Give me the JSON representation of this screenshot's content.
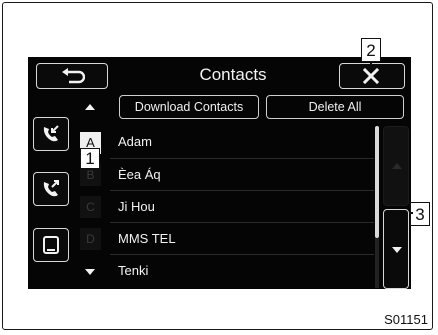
{
  "header": {
    "title": "Contacts"
  },
  "sidebar": {
    "icons": [
      "phone-incoming-icon",
      "phone-outgoing-icon",
      "phonebook-icon"
    ]
  },
  "alpha_index": [
    "A",
    "B",
    "C",
    "D"
  ],
  "actions": {
    "download_label": "Download Contacts",
    "delete_label": "Delete All"
  },
  "contacts": [
    "Adam",
    "Èea Áq",
    "Ji Hou",
    "MMS TEL",
    "Tenki"
  ],
  "callouts": [
    "1",
    "2",
    "3"
  ],
  "figure_code": "S01151",
  "colors": {
    "screen": "#050505",
    "text": "#f2f2f2",
    "frame": "#1a1a1a"
  }
}
